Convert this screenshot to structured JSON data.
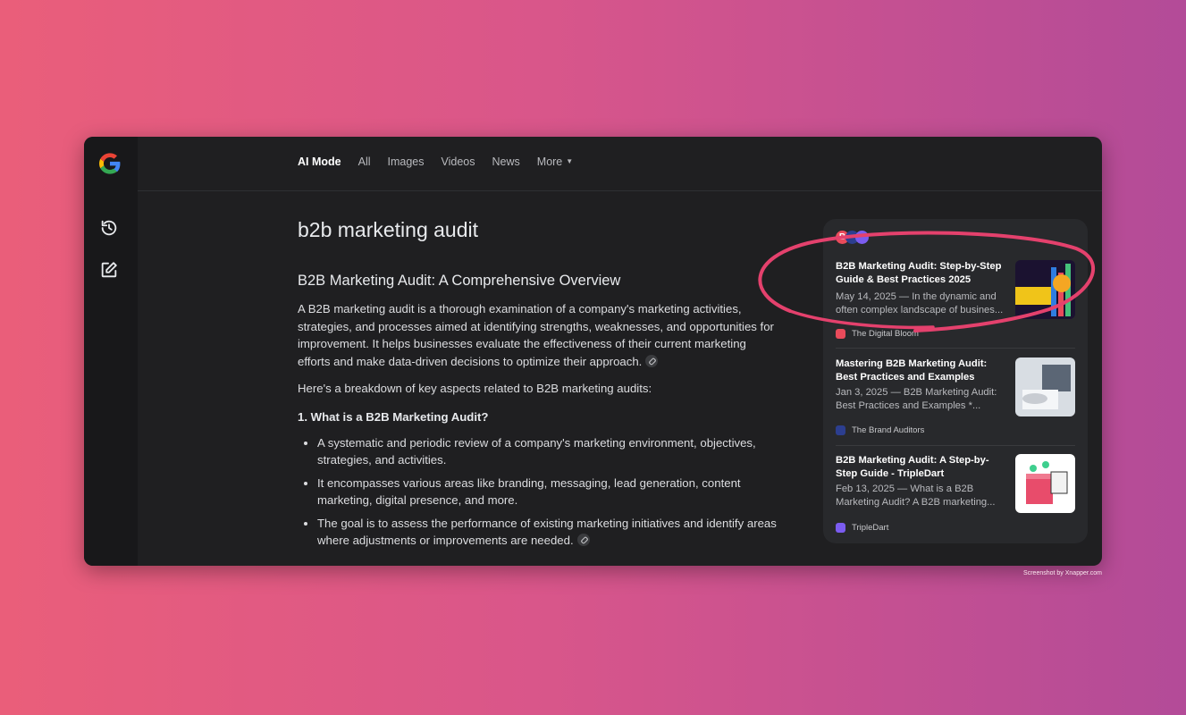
{
  "nav": {
    "tabs": [
      {
        "label": "AI Mode",
        "active": true
      },
      {
        "label": "All"
      },
      {
        "label": "Images"
      },
      {
        "label": "Videos"
      },
      {
        "label": "News"
      },
      {
        "label": "More"
      }
    ]
  },
  "sidebar": {
    "icons": [
      "google-logo",
      "history-icon",
      "new-chat-icon"
    ]
  },
  "main": {
    "query": "b2b marketing audit",
    "heading": "B2B Marketing Audit: A Comprehensive Overview",
    "intro": "A B2B marketing audit is a thorough examination of a company's marketing activities, strategies, and processes aimed at identifying strengths, weaknesses, and opportunities for improvement. It helps businesses evaluate the effectiveness of their current marketing efforts and make data-driven decisions to optimize their approach.",
    "breakdown": "Here's a breakdown of key aspects related to B2B marketing audits:",
    "section_title": "1. What is a B2B Marketing Audit?",
    "bullets": [
      "A systematic and periodic review of a company's marketing environment, objectives, strategies, and activities.",
      "It encompasses various areas like branding, messaging, lead generation, content marketing, digital presence, and more.",
      "The goal is to assess the performance of existing marketing initiatives and identify areas where adjustments or improvements are needed."
    ]
  },
  "sources": {
    "header_letter": "B",
    "items": [
      {
        "title": "B2B Marketing Audit: Step-by-Step Guide & Best Practices 2025",
        "snippet": "May 14, 2025 — In the dynamic and often complex landscape of busines...",
        "site": "The Digital Bloom",
        "site_color": "#e94b5b"
      },
      {
        "title": "Mastering B2B Marketing Audit: Best Practices and Examples",
        "snippet": "Jan 3, 2025 — B2B Marketing Audit: Best Practices and Examples *...",
        "site": "The Brand Auditors",
        "site_color": "#2c3e8f"
      },
      {
        "title": "B2B Marketing Audit: A Step-by-Step Guide - TripleDart",
        "snippet": "Feb 13, 2025 — What is a B2B Marketing Audit? A B2B marketing...",
        "site": "TripleDart",
        "site_color": "#7b5cf0"
      }
    ]
  },
  "colors": {
    "annotation": "#e4416d",
    "background_start": "#ea5e7a",
    "background_end": "#b34b98"
  },
  "watermark": "Screenshot by Xnapper.com"
}
